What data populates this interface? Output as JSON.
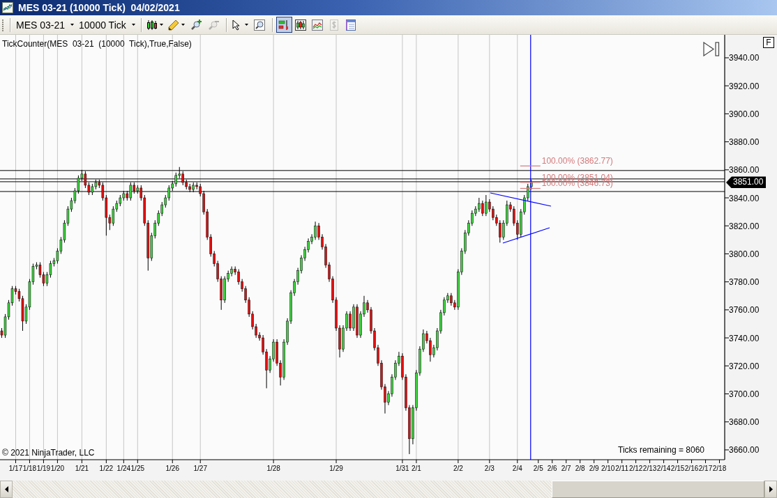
{
  "window": {
    "title": "MES 03-21 (10000 Tick)  04/02/2021"
  },
  "toolbar": {
    "instrument": "MES 03-21",
    "interval": "10000 Tick",
    "tools": [
      {
        "disabled": false
      },
      {
        "disabled": false
      },
      {
        "disabled": false
      },
      {
        "disabled": true
      },
      {
        "disabled": false
      },
      {
        "disabled": false
      }
    ],
    "views": [
      {
        "selected": true,
        "disabled": false
      },
      {
        "selected": false,
        "disabled": false
      },
      {
        "selected": false,
        "disabled": false
      },
      {
        "selected": false,
        "disabled": true
      },
      {
        "selected": false,
        "disabled": false
      }
    ]
  },
  "chart": {
    "indicator_label": "TickCounter(MES  03-21  (10000  Tick),True,False)",
    "scale_button": "F",
    "price_marker": "3851.00",
    "copyright": "© 2021 NinjaTrader, LLC",
    "ticks_remaining": "Ticks remaining = 8060",
    "chart_data": {
      "type": "candlestick",
      "categories": [
        null,
        null,
        null,
        null,
        "1/17",
        null,
        null,
        null,
        "1/18",
        null,
        null,
        null,
        "1/19",
        null,
        null,
        null,
        "1/20",
        null,
        null,
        null,
        null,
        null,
        null,
        "1/21",
        null,
        null,
        null,
        null,
        null,
        null,
        "1/22",
        null,
        null,
        null,
        null,
        "1/24",
        null,
        null,
        null,
        "1/25",
        null,
        null,
        null,
        null,
        null,
        null,
        null,
        null,
        null,
        "1/26",
        null,
        null,
        null,
        null,
        null,
        null,
        null,
        "1/27",
        null,
        null,
        null,
        null,
        null,
        null,
        null,
        null,
        null,
        null,
        null,
        null,
        null,
        null,
        null,
        null,
        null,
        null,
        null,
        null,
        "1/28",
        null,
        null,
        null,
        null,
        null,
        null,
        null,
        null,
        null,
        null,
        null,
        null,
        null,
        null,
        null,
        null,
        null,
        "1/29",
        null,
        null,
        null,
        null,
        null,
        null,
        null,
        null,
        null,
        null,
        null,
        null,
        null,
        null,
        null,
        null,
        null,
        null,
        "1/31",
        null,
        null,
        null,
        "2/1",
        null,
        null,
        null,
        null,
        null,
        null,
        null,
        null,
        null,
        null,
        null,
        "2/2",
        null,
        null,
        null,
        null,
        null,
        null,
        null,
        null,
        "2/3",
        null,
        null,
        null,
        null,
        null,
        null,
        null,
        "2/4",
        null,
        null,
        null,
        null,
        null,
        "2/5",
        null,
        null,
        null,
        "2/6",
        null,
        null,
        null,
        "2/7",
        null,
        null,
        null,
        "2/8",
        null,
        null,
        null,
        "2/9",
        null,
        null,
        null,
        "2/10",
        null,
        null,
        null,
        "2/11",
        null,
        null,
        null,
        "2/12",
        null,
        null,
        null,
        "2/13",
        null,
        null,
        null,
        "2/14",
        null,
        null,
        null,
        "2/15",
        null,
        null,
        null,
        "2/16",
        null,
        null,
        null,
        "2/17",
        null,
        null,
        null,
        "2/18",
        null
      ],
      "ohlc": [
        [
          3745,
          3747,
          3740,
          3742
        ],
        [
          3742,
          3757,
          3740,
          3755
        ],
        [
          3755,
          3767,
          3753,
          3765
        ],
        [
          3765,
          3777,
          3763,
          3775
        ],
        [
          3775,
          3777,
          3771,
          3773
        ],
        [
          3773,
          3775,
          3766,
          3768
        ],
        [
          3768,
          3770,
          3745,
          3752
        ],
        [
          3752,
          3764,
          3750,
          3762
        ],
        [
          3762,
          3782,
          3760,
          3780
        ],
        [
          3780,
          3793,
          3778,
          3791
        ],
        [
          3791,
          3794,
          3789,
          3792
        ],
        [
          3792,
          3794,
          3783,
          3785
        ],
        [
          3785,
          3787,
          3777,
          3779
        ],
        [
          3779,
          3787,
          3777,
          3785
        ],
        [
          3785,
          3795,
          3783,
          3793
        ],
        [
          3793,
          3797,
          3791,
          3795
        ],
        [
          3795,
          3804,
          3793,
          3802
        ],
        [
          3802,
          3812,
          3800,
          3810
        ],
        [
          3810,
          3824,
          3808,
          3822
        ],
        [
          3822,
          3834,
          3820,
          3832
        ],
        [
          3832,
          3840,
          3830,
          3838
        ],
        [
          3838,
          3847,
          3836,
          3845
        ],
        [
          3845,
          3856,
          3843,
          3854
        ],
        [
          3854,
          3860,
          3852,
          3857
        ],
        [
          3857,
          3859,
          3847,
          3849
        ],
        [
          3849,
          3851,
          3842,
          3844
        ],
        [
          3844,
          3850,
          3842,
          3848
        ],
        [
          3848,
          3853,
          3846,
          3851
        ],
        [
          3851,
          3853,
          3847,
          3849
        ],
        [
          3849,
          3851,
          3838,
          3840
        ],
        [
          3840,
          3842,
          3813,
          3826
        ],
        [
          3826,
          3828,
          3817,
          3822
        ],
        [
          3822,
          3834,
          3820,
          3832
        ],
        [
          3832,
          3838,
          3830,
          3836
        ],
        [
          3836,
          3842,
          3834,
          3840
        ],
        [
          3840,
          3845,
          3838,
          3843
        ],
        [
          3843,
          3845,
          3838,
          3840
        ],
        [
          3840,
          3851,
          3838,
          3849
        ],
        [
          3849,
          3851,
          3843,
          3845
        ],
        [
          3845,
          3849,
          3843,
          3847
        ],
        [
          3847,
          3849,
          3838,
          3840
        ],
        [
          3840,
          3842,
          3820,
          3822
        ],
        [
          3822,
          3824,
          3788,
          3797
        ],
        [
          3797,
          3815,
          3795,
          3813
        ],
        [
          3813,
          3824,
          3811,
          3822
        ],
        [
          3822,
          3831,
          3820,
          3829
        ],
        [
          3829,
          3837,
          3827,
          3835
        ],
        [
          3835,
          3842,
          3833,
          3840
        ],
        [
          3840,
          3849,
          3838,
          3847
        ],
        [
          3847,
          3852,
          3845,
          3850
        ],
        [
          3850,
          3858,
          3848,
          3856
        ],
        [
          3856,
          3862,
          3854,
          3857
        ],
        [
          3857,
          3859,
          3849,
          3851
        ],
        [
          3851,
          3853,
          3846,
          3848
        ],
        [
          3848,
          3850,
          3844,
          3846
        ],
        [
          3846,
          3851,
          3844,
          3849
        ],
        [
          3849,
          3851,
          3846,
          3848
        ],
        [
          3848,
          3850,
          3841,
          3843
        ],
        [
          3843,
          3845,
          3828,
          3830
        ],
        [
          3830,
          3832,
          3810,
          3812
        ],
        [
          3812,
          3814,
          3798,
          3800
        ],
        [
          3800,
          3802,
          3791,
          3793
        ],
        [
          3793,
          3795,
          3780,
          3782
        ],
        [
          3782,
          3784,
          3760,
          3767
        ],
        [
          3767,
          3784,
          3765,
          3782
        ],
        [
          3782,
          3788,
          3780,
          3786
        ],
        [
          3786,
          3791,
          3784,
          3789
        ],
        [
          3789,
          3791,
          3785,
          3787
        ],
        [
          3787,
          3789,
          3778,
          3780
        ],
        [
          3780,
          3782,
          3773,
          3775
        ],
        [
          3775,
          3777,
          3765,
          3767
        ],
        [
          3767,
          3769,
          3755,
          3757
        ],
        [
          3757,
          3759,
          3746,
          3748
        ],
        [
          3748,
          3750,
          3740,
          3742
        ],
        [
          3742,
          3744,
          3738,
          3740
        ],
        [
          3740,
          3742,
          3728,
          3730
        ],
        [
          3730,
          3732,
          3704,
          3717
        ],
        [
          3717,
          3727,
          3715,
          3725
        ],
        [
          3725,
          3739,
          3723,
          3737
        ],
        [
          3737,
          3739,
          3720,
          3722
        ],
        [
          3722,
          3724,
          3706,
          3712
        ],
        [
          3712,
          3739,
          3710,
          3737
        ],
        [
          3737,
          3754,
          3735,
          3752
        ],
        [
          3752,
          3774,
          3750,
          3772
        ],
        [
          3772,
          3782,
          3770,
          3780
        ],
        [
          3780,
          3790,
          3778,
          3788
        ],
        [
          3788,
          3799,
          3786,
          3797
        ],
        [
          3797,
          3805,
          3795,
          3803
        ],
        [
          3803,
          3811,
          3801,
          3809
        ],
        [
          3809,
          3814,
          3807,
          3812
        ],
        [
          3812,
          3823,
          3810,
          3820
        ],
        [
          3820,
          3822,
          3810,
          3812
        ],
        [
          3812,
          3814,
          3803,
          3805
        ],
        [
          3805,
          3807,
          3790,
          3792
        ],
        [
          3792,
          3794,
          3780,
          3782
        ],
        [
          3782,
          3784,
          3765,
          3767
        ],
        [
          3767,
          3769,
          3745,
          3747
        ],
        [
          3747,
          3749,
          3726,
          3732
        ],
        [
          3732,
          3749,
          3730,
          3747
        ],
        [
          3747,
          3759,
          3745,
          3757
        ],
        [
          3757,
          3759,
          3745,
          3747
        ],
        [
          3747,
          3764,
          3745,
          3762
        ],
        [
          3762,
          3764,
          3740,
          3742
        ],
        [
          3742,
          3759,
          3740,
          3757
        ],
        [
          3757,
          3770,
          3755,
          3765
        ],
        [
          3765,
          3767,
          3758,
          3760
        ],
        [
          3760,
          3762,
          3743,
          3745
        ],
        [
          3745,
          3747,
          3731,
          3733
        ],
        [
          3733,
          3735,
          3720,
          3722
        ],
        [
          3722,
          3724,
          3703,
          3705
        ],
        [
          3705,
          3707,
          3686,
          3694
        ],
        [
          3694,
          3702,
          3692,
          3700
        ],
        [
          3700,
          3714,
          3698,
          3712
        ],
        [
          3712,
          3724,
          3710,
          3722
        ],
        [
          3722,
          3730,
          3720,
          3727
        ],
        [
          3727,
          3729,
          3710,
          3712
        ],
        [
          3712,
          3714,
          3688,
          3690
        ],
        [
          3690,
          3692,
          3657,
          3668
        ],
        [
          3668,
          3692,
          3664,
          3690
        ],
        [
          3690,
          3717,
          3688,
          3715
        ],
        [
          3715,
          3734,
          3713,
          3732
        ],
        [
          3732,
          3746,
          3730,
          3743
        ],
        [
          3743,
          3745,
          3736,
          3738
        ],
        [
          3738,
          3740,
          3723,
          3728
        ],
        [
          3728,
          3735,
          3726,
          3733
        ],
        [
          3733,
          3747,
          3731,
          3745
        ],
        [
          3745,
          3760,
          3743,
          3758
        ],
        [
          3758,
          3769,
          3756,
          3767
        ],
        [
          3767,
          3772,
          3765,
          3770
        ],
        [
          3770,
          3772,
          3763,
          3765
        ],
        [
          3765,
          3767,
          3760,
          3762
        ],
        [
          3762,
          3789,
          3760,
          3787
        ],
        [
          3787,
          3804,
          3785,
          3802
        ],
        [
          3802,
          3817,
          3800,
          3815
        ],
        [
          3815,
          3824,
          3813,
          3822
        ],
        [
          3822,
          3831,
          3820,
          3829
        ],
        [
          3829,
          3834,
          3827,
          3832
        ],
        [
          3832,
          3840,
          3830,
          3836
        ],
        [
          3836,
          3838,
          3827,
          3829
        ],
        [
          3829,
          3842,
          3827,
          3837
        ],
        [
          3837,
          3839,
          3830,
          3832
        ],
        [
          3832,
          3834,
          3824,
          3826
        ],
        [
          3826,
          3828,
          3820,
          3822
        ],
        [
          3822,
          3824,
          3808,
          3812
        ],
        [
          3812,
          3824,
          3810,
          3822
        ],
        [
          3822,
          3838,
          3820,
          3835
        ],
        [
          3835,
          3837,
          3830,
          3832
        ],
        [
          3832,
          3834,
          3820,
          3822
        ],
        [
          3822,
          3824,
          3810,
          3814
        ],
        [
          3814,
          3832,
          3812,
          3830
        ],
        [
          3830,
          3842,
          3828,
          3840
        ],
        [
          3840,
          3850,
          3838,
          3848
        ],
        [
          3848,
          3853,
          3846,
          3851
        ],
        null,
        null,
        null,
        null,
        null,
        null,
        null,
        null,
        null,
        null,
        null,
        null,
        null,
        null,
        null,
        null,
        null,
        null,
        null,
        null,
        null,
        null,
        null,
        null,
        null,
        null,
        null,
        null,
        null,
        null,
        null,
        null,
        null,
        null,
        null,
        null,
        null,
        null,
        null,
        null,
        null,
        null,
        null,
        null,
        null,
        null,
        null,
        null,
        null,
        null,
        null,
        null,
        null,
        null,
        null
      ],
      "ylim": [
        3653,
        3956.4
      ],
      "yticks": [
        {
          "value": 3940,
          "label": "3940.00"
        },
        {
          "value": 3920,
          "label": "3920.00"
        },
        {
          "value": 3900,
          "label": "3900.00"
        },
        {
          "value": 3880,
          "label": "3880.00"
        },
        {
          "value": 3860,
          "label": "3860.00"
        },
        {
          "value": 3840,
          "label": "3840.00"
        },
        {
          "value": 3820,
          "label": "3820.00"
        },
        {
          "value": 3800,
          "label": "3800.00"
        },
        {
          "value": 3780,
          "label": "3780.00"
        },
        {
          "value": 3760,
          "label": "3760.00"
        },
        {
          "value": 3740,
          "label": "3740.00"
        },
        {
          "value": 3720,
          "label": "3720.00"
        },
        {
          "value": 3700,
          "label": "3700.00"
        },
        {
          "value": 3680,
          "label": "3680.00"
        },
        {
          "value": 3660,
          "label": "3660.00"
        }
      ],
      "ref_lines": [
        {
          "axis": "y",
          "value": 3859.5,
          "color": "#000000"
        },
        {
          "axis": "y",
          "value": 3853.5,
          "color": "#000000"
        },
        {
          "axis": "y",
          "value": 3851.5,
          "color": "#000000"
        },
        {
          "axis": "y",
          "value": 3844.5,
          "color": "#000000"
        },
        {
          "axis": "y",
          "value": 3862.77,
          "label": "100.00% (3862.77)",
          "color": "#d47a7a"
        },
        {
          "axis": "y",
          "value": 3851.04,
          "label": "100.00% (3851.04)",
          "color": "#d47a7a"
        },
        {
          "axis": "y",
          "value": 3846.73,
          "label": "100.00% (3846.73)",
          "color": "#d47a7a"
        }
      ]
    }
  }
}
